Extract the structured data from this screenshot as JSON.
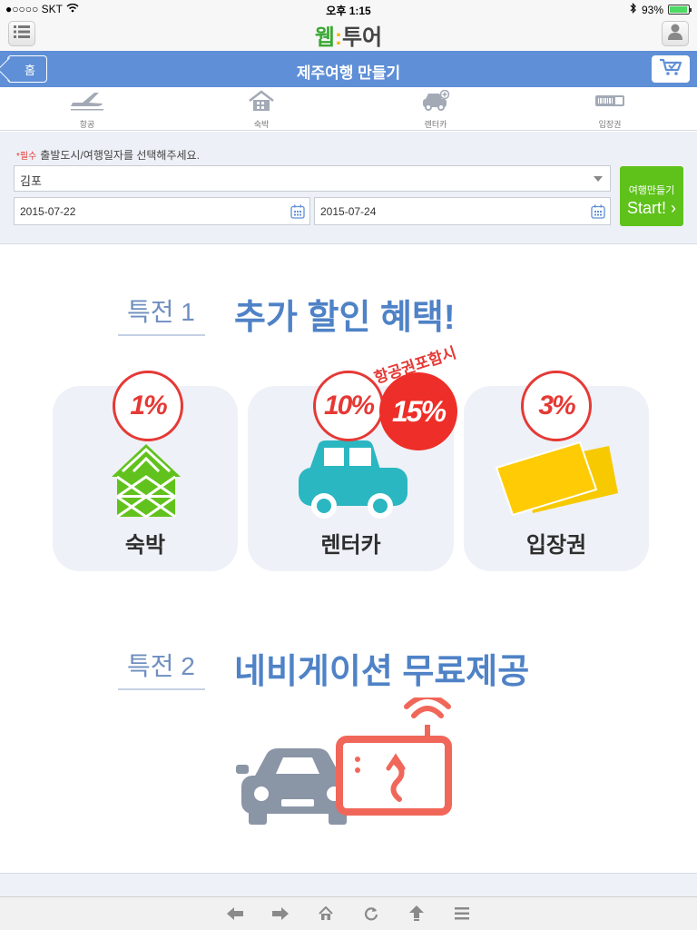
{
  "status_bar": {
    "carrier": "●○○○○ SKT",
    "time": "오후 1:15",
    "battery": "93%",
    "battery_level": 0.93
  },
  "header": {
    "logo_part1": "웹",
    "logo_part2": "투어"
  },
  "titlebar": {
    "home_label": "홈",
    "title": "제주여행 만들기"
  },
  "tabs": [
    {
      "label": "항공",
      "icon": "airplane-icon"
    },
    {
      "label": "숙박",
      "icon": "house-icon"
    },
    {
      "label": "렌터카",
      "icon": "car-icon"
    },
    {
      "label": "입장권",
      "icon": "ticket-icon"
    }
  ],
  "search": {
    "required_mark": "*필수",
    "instruction": "출발도시/여행일자를 선택해주세요.",
    "departure_city": "김포",
    "date_from": "2015-07-22",
    "date_to": "2015-07-24",
    "start_small": "여행만들기",
    "start_big": "Start! ›"
  },
  "perk1": {
    "label": "특전 1",
    "title": "추가 할인 혜택!",
    "cards": [
      {
        "label": "숙박",
        "discount": "1%"
      },
      {
        "label": "렌터카",
        "discount": "10%",
        "extra_discount": "15%",
        "extra_note": "항공권포함시"
      },
      {
        "label": "입장권",
        "discount": "3%"
      }
    ]
  },
  "perk2": {
    "label": "특전 2",
    "title": "네비게이션 무료제공"
  },
  "colors": {
    "accent_blue": "#5f8fd6",
    "start_green": "#5ec21a",
    "discount_red": "#e53935"
  }
}
